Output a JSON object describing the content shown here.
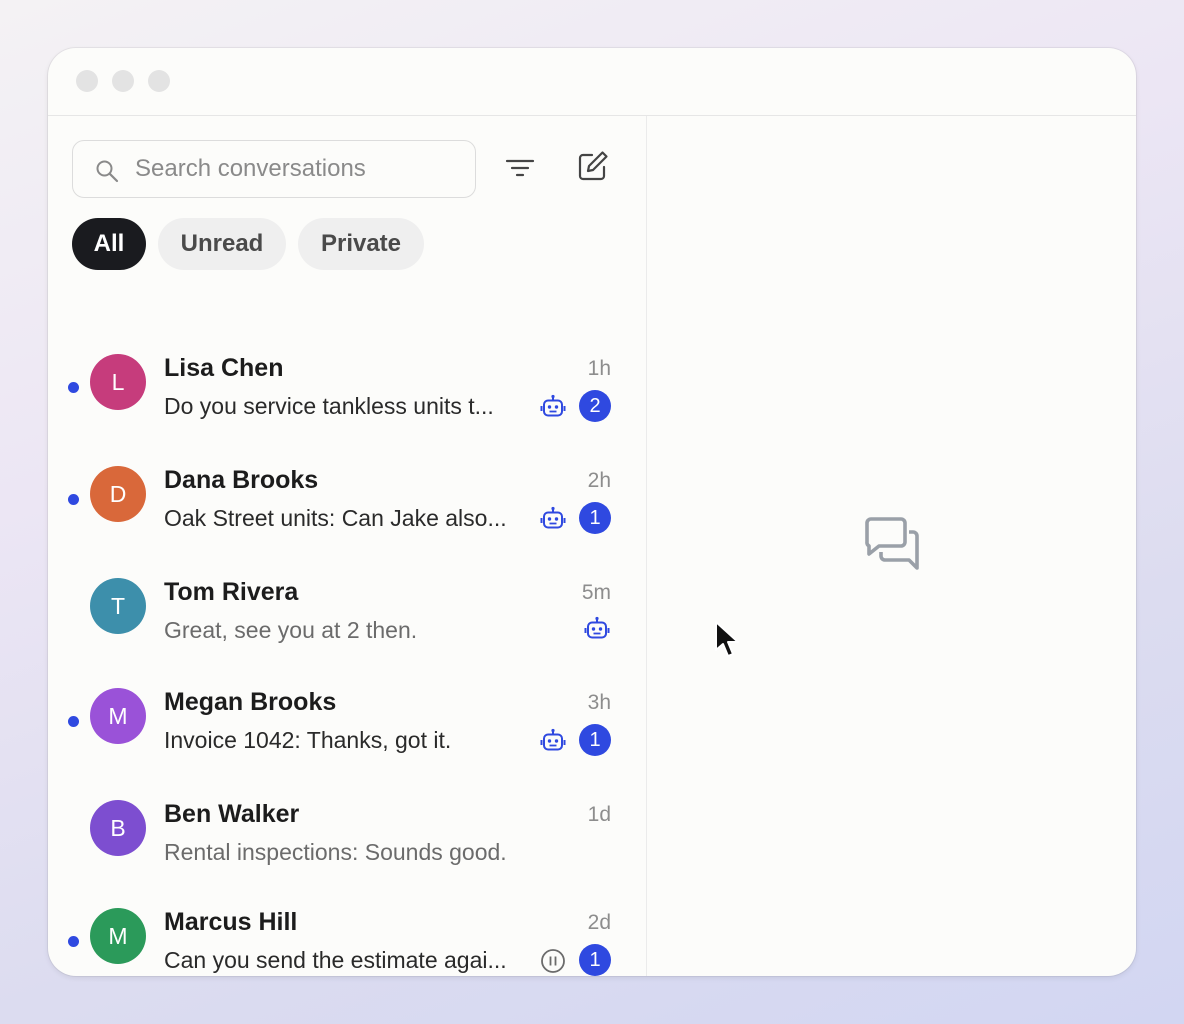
{
  "search": {
    "placeholder": "Search conversations"
  },
  "filters": [
    {
      "label": "All",
      "active": true
    },
    {
      "label": "Unread",
      "active": false
    },
    {
      "label": "Private",
      "active": false
    }
  ],
  "conversations": [
    {
      "initial": "L",
      "name": "Lisa Chen",
      "time": "1h",
      "preview": "Do you service tankless units t...",
      "unread": true,
      "badge": "2",
      "status_icon": "bot-icon",
      "avatar_color": "#c63c7c"
    },
    {
      "initial": "D",
      "name": "Dana Brooks",
      "time": "2h",
      "preview": "Oak Street units: Can Jake also...",
      "unread": true,
      "badge": "1",
      "status_icon": "bot-icon",
      "avatar_color": "#d9683a"
    },
    {
      "initial": "T",
      "name": "Tom Rivera",
      "time": "5m",
      "preview": "Great, see you at 2 then.",
      "unread": false,
      "badge": "",
      "status_icon": "bot-icon",
      "avatar_color": "#3d8fab"
    },
    {
      "initial": "M",
      "name": "Megan Brooks",
      "time": "3h",
      "preview": "Invoice 1042: Thanks, got it.",
      "unread": true,
      "badge": "1",
      "status_icon": "bot-icon",
      "avatar_color": "#9a52d8"
    },
    {
      "initial": "B",
      "name": "Ben Walker",
      "time": "1d",
      "preview": "Rental inspections: Sounds good.",
      "unread": false,
      "badge": "",
      "status_icon": "",
      "avatar_color": "#7d4ed0"
    },
    {
      "initial": "M",
      "name": "Marcus Hill",
      "time": "2d",
      "preview": "Can you send the estimate agai...",
      "unread": true,
      "badge": "1",
      "status_icon": "pause-icon",
      "avatar_color": "#2b9a5a"
    }
  ],
  "colors": {
    "accent": "#2f49e0",
    "chip_active": "#1a1b1f",
    "chip_idle": "#efefef"
  }
}
